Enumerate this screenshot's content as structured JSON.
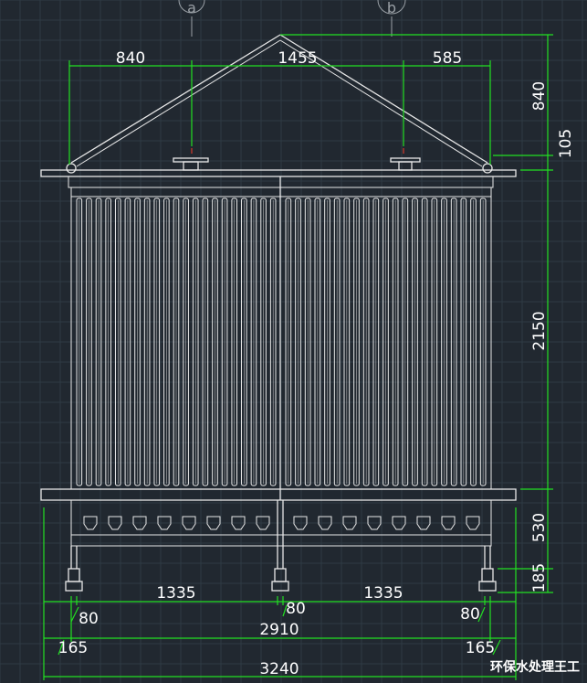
{
  "diagram": {
    "axis_labels": [
      {
        "id": "axis-a",
        "text": "a"
      },
      {
        "id": "axis-b",
        "text": "b"
      }
    ],
    "top_dims": [
      "840",
      "1455",
      "585"
    ],
    "right_dims": [
      "840",
      "105",
      "2150",
      "530",
      "185"
    ],
    "bottom_dims": {
      "row1": [
        "1335",
        "1335"
      ],
      "row1_small": [
        "80",
        "80",
        "80"
      ],
      "row2": "2910",
      "row3": [
        "165",
        "165"
      ],
      "row4": "3240"
    }
  },
  "watermark": "环保水处理王工",
  "colors": {
    "background": "#212830",
    "dimension": "#22e022",
    "linework": "#e8e8e8",
    "accent": "#d23a2a"
  }
}
